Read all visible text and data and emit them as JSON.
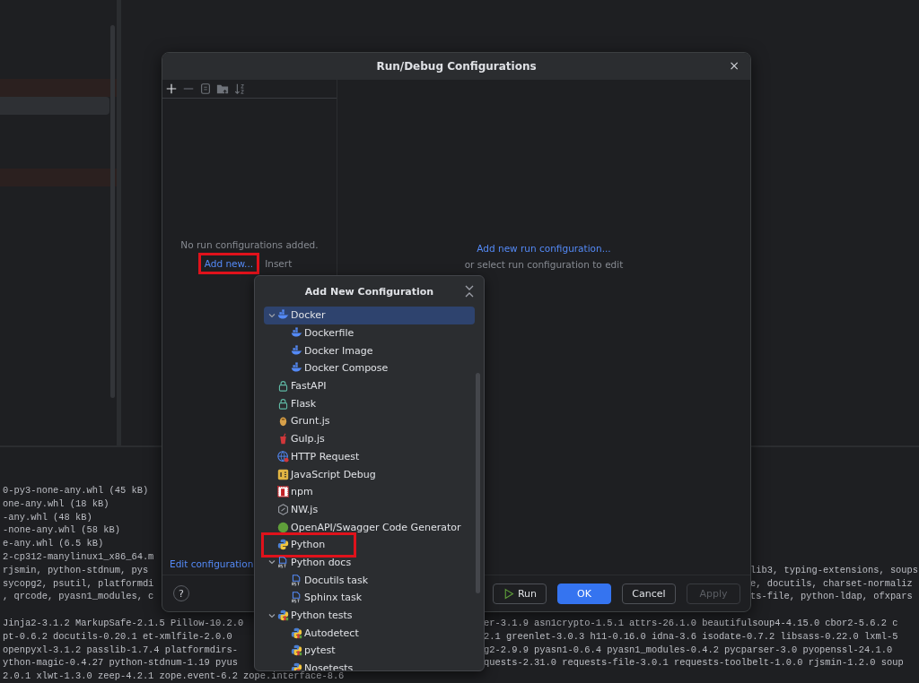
{
  "terminal": {
    "lines": [
      {
        "kind": "under-dialog",
        "left": "0-py3-none-any.whl (45 kB)"
      },
      {
        "kind": "under-dialog",
        "left": "one-any.whl (18 kB)"
      },
      {
        "kind": "under-dialog",
        "left": "-any.whl (48 kB)"
      },
      {
        "kind": "under-dialog",
        "left": "-none-any.whl (58 kB)"
      },
      {
        "kind": "under-dialog",
        "left": "e-any.whl (6.5 kB)"
      },
      {
        "kind": "under-dialog",
        "left": "2-cp312-manylinux1_x86_64.m"
      },
      {
        "kind": "under-dialog",
        "left": "rjsmin, python-stdnum, pys",
        "right": "lib3, typing-extensions, soups"
      },
      {
        "kind": "under-dialog",
        "left": "sycopg2, psutil, platformdi",
        "right": "e, docutils, charset-normaliz"
      },
      {
        "kind": "under-dialog",
        "left": ", qrcode, pyasn1_modules, c",
        "right": "ts-file, python-ldap, ofxpars"
      },
      {
        "kind": "blank"
      },
      {
        "kind": "under-popup",
        "left": "Jinja2-3.1.2 MarkupSafe-2.1.5 Pillow-10.2.0",
        "right": "er-3.1.9 asn1crypto-1.5.1 attrs-26.1.0 beautifulsoup4-4.15.0 cbor2-5.6.2 c"
      },
      {
        "kind": "under-popup",
        "left": "pt-0.6.2 docutils-0.20.1 et-xmlfile-2.0.0",
        "right": "2.1 greenlet-3.0.3 h11-0.16.0 idna-3.6 isodate-0.7.2 libsass-0.22.0 lxml-5"
      },
      {
        "kind": "under-popup",
        "left": "openpyxl-3.1.2 passlib-1.7.4 platformdirs-",
        "right": "g2-2.9.9 pyasn1-0.6.4 pyasn1_modules-0.4.2 pycparser-3.0 pyopenssl-24.1.0"
      },
      {
        "kind": "under-popup",
        "left": "ython-magic-0.4.27 python-stdnum-1.19 pyus",
        "right": "quests-2.31.0 requests-file-3.0.1 requests-toolbelt-1.0.0 rjsmin-1.2.0 soup"
      },
      {
        "kind": "full",
        "left": "2.0.1 xlwt-1.3.0 zeep-4.2.1 zope.event-6.2 zope.interface-8.6"
      }
    ]
  },
  "project_tree": {
    "rows": [
      {
        "kind": "spacer"
      },
      {
        "kind": "warning"
      },
      {
        "kind": "selected"
      },
      {
        "kind": "spacer"
      },
      {
        "kind": "spacer"
      },
      {
        "kind": "spacer"
      },
      {
        "kind": "warning"
      }
    ]
  },
  "dialog": {
    "title": "Run/Debug Configurations",
    "close": "×",
    "empty_message": "No run configurations added.",
    "add_link": {
      "label": "Add new...",
      "highlighted": true
    },
    "shortcut": "Insert",
    "right_link": "Add new run configuration...",
    "right_hint": "or select run configuration to edit",
    "templates_link": "Edit configuration",
    "help": "?",
    "buttons": [
      {
        "kind": "run",
        "label": "Run",
        "disabled": false
      },
      {
        "kind": "primary",
        "label": "OK",
        "disabled": false
      },
      {
        "kind": "plain",
        "label": "Cancel",
        "disabled": false
      },
      {
        "kind": "plain",
        "label": "Apply",
        "disabled": true
      }
    ]
  },
  "popup": {
    "title": "Add New Configuration",
    "items": [
      {
        "label": "Docker",
        "kind": "docker",
        "selected": true,
        "expanded": true,
        "children": [
          {
            "label": "Dockerfile",
            "kind": "docker",
            "selected": false
          },
          {
            "label": "Docker Image",
            "kind": "docker",
            "selected": false
          },
          {
            "label": "Docker Compose",
            "kind": "docker",
            "selected": false
          }
        ]
      },
      {
        "label": "FastAPI",
        "kind": "lock",
        "selected": false
      },
      {
        "label": "Flask",
        "kind": "lock",
        "selected": false
      },
      {
        "label": "Grunt.js",
        "kind": "grunt",
        "selected": false
      },
      {
        "label": "Gulp.js",
        "kind": "gulp",
        "selected": false
      },
      {
        "label": "HTTP Request",
        "kind": "globe",
        "selected": false
      },
      {
        "label": "JavaScript Debug",
        "kind": "js",
        "selected": false
      },
      {
        "label": "npm",
        "kind": "npm",
        "selected": false
      },
      {
        "label": "NW.js",
        "kind": "nw",
        "selected": false
      },
      {
        "label": "OpenAPI/Swagger Code Generator",
        "kind": "openapi",
        "selected": false
      },
      {
        "label": "Python",
        "kind": "python",
        "selected": false,
        "highlighted": true
      },
      {
        "label": "Python docs",
        "kind": "rst",
        "selected": false,
        "expanded": true,
        "children": [
          {
            "label": "Docutils task",
            "kind": "rst",
            "selected": false
          },
          {
            "label": "Sphinx task",
            "kind": "rst",
            "selected": false
          }
        ]
      },
      {
        "label": "Python tests",
        "kind": "pytest",
        "selected": false,
        "expanded": true,
        "children": [
          {
            "label": "Autodetect",
            "kind": "pytest",
            "selected": false
          },
          {
            "label": "pytest",
            "kind": "pytest",
            "selected": false
          },
          {
            "label": "Nosetests",
            "kind": "pytest",
            "selected": false
          }
        ]
      }
    ]
  }
}
